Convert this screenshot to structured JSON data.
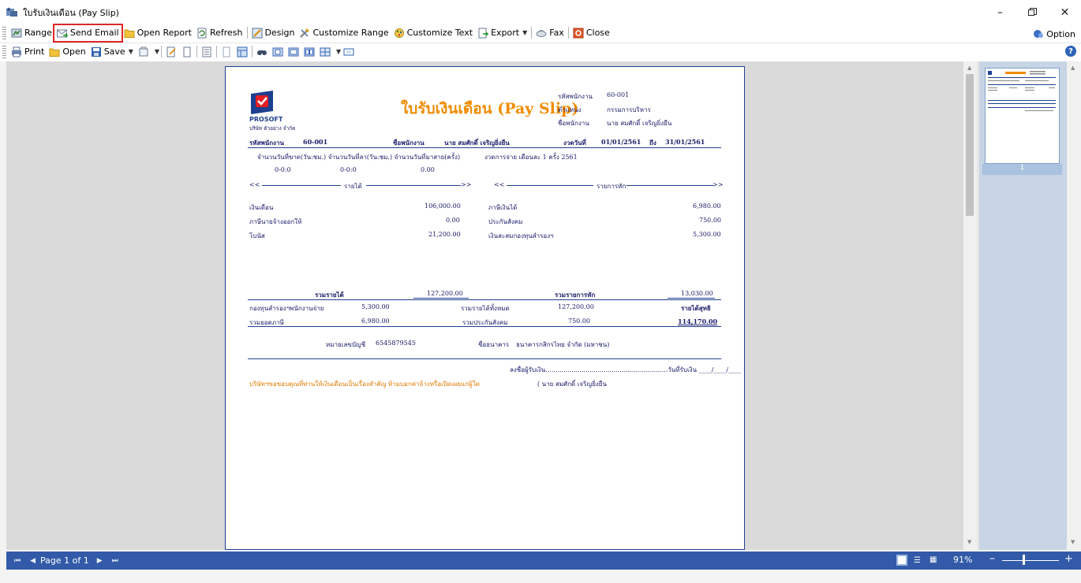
{
  "window": {
    "title": "ใบรับเงินเดือน (Pay Slip)"
  },
  "toolbar1": {
    "items": [
      {
        "label": "Range"
      },
      {
        "label": "Send Email"
      },
      {
        "label": "Open Report"
      },
      {
        "label": "Refresh"
      },
      {
        "label": "Design"
      },
      {
        "label": "Customize Range"
      },
      {
        "label": "Customize Text"
      },
      {
        "label": "Export"
      },
      {
        "label": "Fax"
      },
      {
        "label": "Close"
      }
    ],
    "option_label": "Option"
  },
  "toolbar2": {
    "print": "Print",
    "open": "Open",
    "save": "Save"
  },
  "slip": {
    "company_logo_text": "PROSOFT",
    "company_name": "บริษัท ตัวอย่าง จำกัด",
    "title": "ใบรับเงินเดือน (Pay Slip)",
    "hdr_emp_code_label": "รหัสพนักงาน",
    "hdr_emp_code": "60-001",
    "hdr_position_label": "ตำแหน่ง",
    "hdr_position": "กรรมการบริหาร",
    "hdr_name_label": "ชื่อพนักงาน",
    "hdr_name": "นาย สมศักดิ์ เจริญยิ่งยืน",
    "row_emp_code_label": "รหัสพนักงาน",
    "row_emp_code": "60-001",
    "row_name_label": "ชื่อพนักงาน",
    "row_name": "นาย สมศักดิ์ เจริญยิ่งยืน",
    "row_period_label": "งวดวันที่",
    "row_period_from": "01/01/2561",
    "row_period_to_label": "ถึง",
    "row_period_to": "31/01/2561",
    "absence_labels": "จำนวนวันที่ขาด(วัน:ชม.)  จำนวนวันที่ลา(วัน:ชม.)  จำนวนวันที่มาสาย(ครั้ง)",
    "pay_cycle": "งวดการจ่าย   เดือนละ 1 ครั้ง 2561",
    "absence_values": [
      "0-0:0",
      "0-0:0",
      "0.00"
    ],
    "income_header": "รายได้",
    "deduct_header": "รายการหัก",
    "income": [
      {
        "label": "เงินเดือน",
        "amount": "106,000.00"
      },
      {
        "label": "ภาษีนายจ้างออกให้",
        "amount": "0.00"
      },
      {
        "label": "โบนัส",
        "amount": "21,200.00"
      }
    ],
    "deductions": [
      {
        "label": "ภาษีเงินได้",
        "amount": "6,980.00"
      },
      {
        "label": "ประกันสังคม",
        "amount": "750.00"
      },
      {
        "label": "เงินสะสมกองทุนสำรองฯ",
        "amount": "5,300.00"
      }
    ],
    "total_income_label": "รวมรายได้",
    "total_income": "127,200.00",
    "total_deduct_label": "รวมรายการหัก",
    "total_deduct": "13,030.00",
    "pf_label": "กองทุนสำรองฯพนักงานจ่าย",
    "pf_value": "5,300.00",
    "total_all_income_label": "รวมรายได้ทั้งหมด",
    "total_all_income": "127,200.00",
    "net_label": "รายได้สุทธิ",
    "tax_total_label": "รวมยอดภาษี",
    "tax_total": "6,980.00",
    "ss_total_label": "รวมประกันสังคม",
    "ss_total": "750.00",
    "net_value": "114,170.00",
    "account_label": "หมายเลขบัญชี",
    "account_no": "6545879545",
    "bank_label": "ชื่อธนาคาร",
    "bank_name": "ธนาคารกสิกรไทย จำกัด (มหาชน)",
    "sign_line": "ลงชื่อผู้รับเงิน.............................................................วันที่รับเงิน ____/____/____",
    "note": "บริษัทฯขอขอบคุณที่ท่านให้เงินเดือนเป็นเรื่องสำคัญ ห้ามบอกค่าจ้างหรือเปิดเผยแก่ผู้ใด",
    "sign_name": "(        นาย สมศักดิ์ เจริญยิ่งยืน"
  },
  "thumbnail": {
    "page_no": "1"
  },
  "status": {
    "page_text": "Page 1 of 1",
    "zoom": "91%"
  }
}
